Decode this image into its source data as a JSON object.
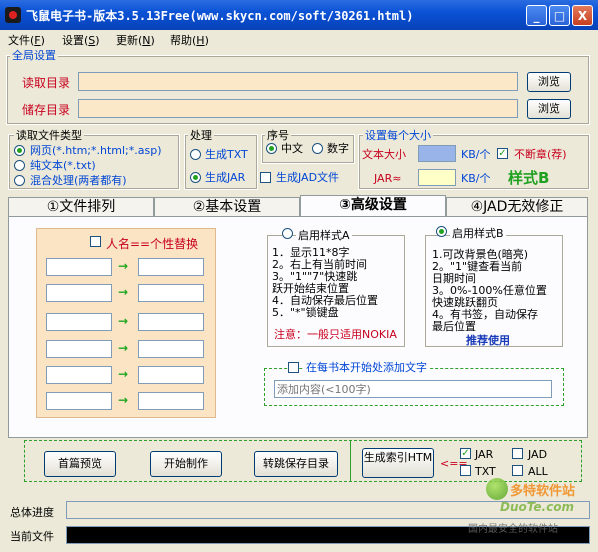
{
  "window": {
    "title": "飞鼠电子书-版本3.5.13Free(www.skycn.com/soft/30261.html)",
    "min_label": "_",
    "max_label": "□",
    "close_label": "X"
  },
  "menu": [
    {
      "label": "文件(",
      "key": "F",
      "end": ")"
    },
    {
      "label": "设置(",
      "key": "S",
      "end": ")"
    },
    {
      "label": "更新(",
      "key": "N",
      "end": ")"
    },
    {
      "label": "帮助(",
      "key": "H",
      "end": ")"
    }
  ],
  "global": {
    "title": "全局设置",
    "read_dir_label": "读取目录",
    "save_dir_label": "储存目录",
    "read_dir_value": "",
    "save_dir_value": "",
    "browse_label": "浏览"
  },
  "read_type": {
    "title": "读取文件类型",
    "options": [
      "网页(*.htm;*.html;*.asp)",
      "纯文本(*.txt)",
      "混合处理(两者都有)"
    ],
    "selected": 0
  },
  "process": {
    "title": "处理",
    "txt_label": "生成TXT",
    "jar_label": "生成JAR",
    "selected": "jar"
  },
  "seq": {
    "title": "序号",
    "chinese_label": "中文",
    "number_label": "数字",
    "selected": "chinese",
    "jad_label": "生成JAD文件"
  },
  "size": {
    "title": "设置每个大小",
    "text_size_label": "文本大小",
    "kb_unit": "KB/个",
    "continuous_label": "不断章(荐)",
    "continuous_checked": true,
    "jar_label": "JAR≈",
    "style_label": "样式B"
  },
  "tabs": [
    "①文件排列",
    "②基本设置",
    "③高级设置",
    "④JAD无效修正"
  ],
  "active_tab": 2,
  "advanced": {
    "name_replace_label": "人名==个性替换",
    "arrow": "→",
    "style_a": {
      "title": "启用样式A",
      "lines": [
        "1．显示11*8字",
        "2。右上有当前时间",
        "3。\"1\"\"7\"快速跳",
        "跃开始结束位置",
        "4．自动保存最后位置",
        "5．\"*\"锁键盘"
      ],
      "note": "注意：一般只适用NOKIA"
    },
    "style_b": {
      "title": "启用样式B",
      "lines": [
        "1.可改背景色(暗亮)",
        "2。\"1\"键查看当前",
        "日期时间",
        "3。0%-100%任意位置",
        "快速跳跃翻页",
        "4。有书签，自动保存",
        "最后位置"
      ],
      "recommend": "推荐使用"
    },
    "add_text_label": "在每书本开始处添加文字",
    "add_text_placeholder": "添加内容(<100字)"
  },
  "actions": {
    "preview": "首篇预览",
    "start": "开始制作",
    "jump_save": "转跳保存目录",
    "gen_index": "生成索引HTM",
    "arrow": "<==",
    "jar": "JAR",
    "jad": "JAD",
    "txt": "TXT",
    "all": "ALL"
  },
  "status": {
    "total_label": "总体进度",
    "current_label": "当前文件"
  },
  "watermark": {
    "line1": "多特软件站",
    "line2": "DuoTe.com",
    "line3": "国内最安全的软件站"
  }
}
